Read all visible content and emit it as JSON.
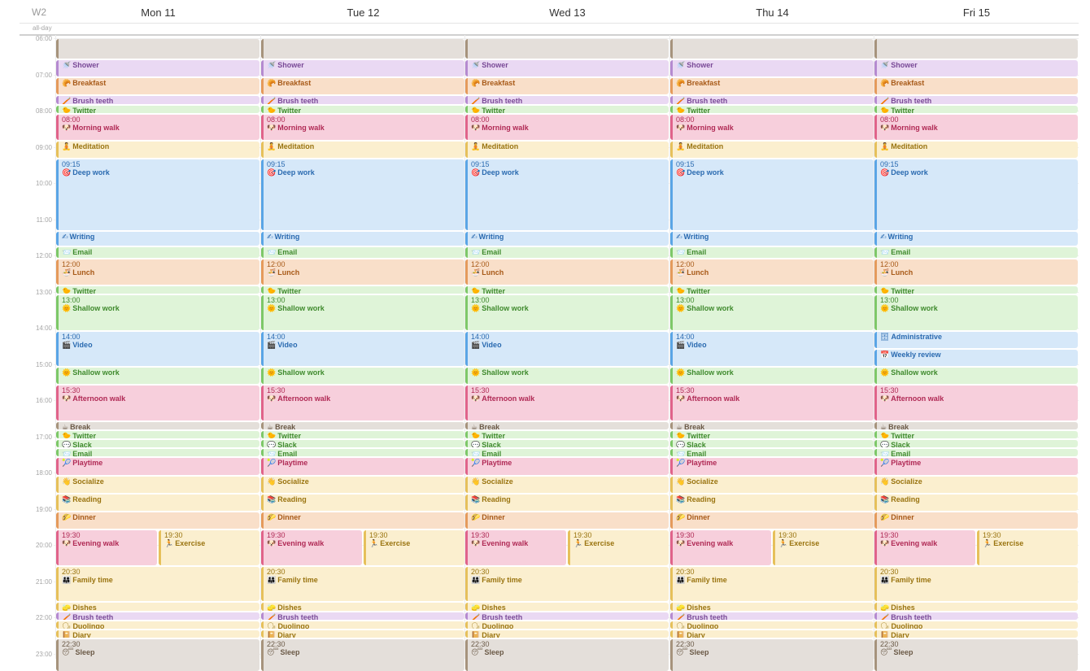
{
  "week_label": "W2",
  "all_day_label": "all-day",
  "days": [
    "Mon 11",
    "Tue 12",
    "Wed 13",
    "Thu 14",
    "Fri 15"
  ],
  "hours": [
    "06:00",
    "07:00",
    "08:00",
    "09:00",
    "10:00",
    "11:00",
    "12:00",
    "13:00",
    "14:00",
    "15:00",
    "16:00",
    "17:00",
    "18:00",
    "19:00",
    "20:00",
    "21:00",
    "22:00",
    "23:00"
  ],
  "categories": {
    "grey": {
      "bg": "#e4dfda",
      "bar": "#a6937c",
      "text": "#6b5a47"
    },
    "purple": {
      "bg": "#ead9f3",
      "bar": "#b58ad0",
      "text": "#7a4a97"
    },
    "orange": {
      "bg": "#f9dfc9",
      "bar": "#e59a5b",
      "text": "#a85a18"
    },
    "green": {
      "bg": "#dff4d8",
      "bar": "#7dc868",
      "text": "#3f8a2d"
    },
    "pink": {
      "bg": "#f7cfdc",
      "bar": "#e0638a",
      "text": "#b02a55"
    },
    "yellow": {
      "bg": "#fbefcf",
      "bar": "#e6c05a",
      "text": "#9a7410"
    },
    "blue": {
      "bg": "#d6e8f9",
      "bar": "#5aa5e6",
      "text": "#2a6ab0"
    }
  },
  "events": [
    {
      "name": "",
      "start": "06:00",
      "end": "06:35",
      "cat": "grey",
      "icon": "",
      "show_time": false
    },
    {
      "name": "Shower",
      "start": "06:35",
      "end": "07:05",
      "cat": "purple",
      "icon": "shower-icon",
      "glyph": "🚿"
    },
    {
      "name": "Breakfast",
      "start": "07:05",
      "end": "07:35",
      "cat": "orange",
      "icon": "breakfast-icon",
      "glyph": "🥐"
    },
    {
      "name": "Brush teeth",
      "start": "07:35",
      "end": "07:50",
      "cat": "purple",
      "icon": "toothbrush-icon",
      "glyph": "🪥"
    },
    {
      "name": "Twitter",
      "start": "07:50",
      "end": "08:05",
      "cat": "green",
      "icon": "bird-icon",
      "glyph": "🐤"
    },
    {
      "name": "Morning walk",
      "start": "08:05",
      "end": "08:50",
      "cat": "pink",
      "icon": "dog-icon",
      "glyph": "🐶",
      "time": "08:00"
    },
    {
      "name": "Meditation",
      "start": "08:50",
      "end": "09:20",
      "cat": "yellow",
      "icon": "meditation-icon",
      "glyph": "🧘"
    },
    {
      "name": "Deep work",
      "start": "09:20",
      "end": "11:20",
      "cat": "blue",
      "icon": "target-icon",
      "glyph": "🎯",
      "time": "09:15"
    },
    {
      "name": "Writing",
      "start": "11:20",
      "end": "11:45",
      "cat": "blue",
      "icon": "writing-hand-icon",
      "glyph": "✍"
    },
    {
      "name": "Email",
      "start": "11:45",
      "end": "12:05",
      "cat": "green",
      "icon": "email-icon",
      "glyph": "📨"
    },
    {
      "name": "Lunch",
      "start": "12:05",
      "end": "12:50",
      "cat": "orange",
      "icon": "bowl-icon",
      "glyph": "🍜",
      "time": "12:00"
    },
    {
      "name": "Twitter",
      "start": "12:50",
      "end": "13:05",
      "cat": "green",
      "icon": "bird-icon",
      "glyph": "🐤"
    },
    {
      "name": "Shallow work",
      "start": "13:05",
      "end": "14:05",
      "cat": "green",
      "icon": "sun-icon",
      "glyph": "🌞",
      "time": "13:00"
    },
    {
      "name": "Video",
      "start": "14:05",
      "end": "15:05",
      "cat": "blue",
      "icon": "clapper-icon",
      "glyph": "🎬",
      "time": "14:00",
      "except": [
        4
      ]
    },
    {
      "name": "Administrative",
      "start": "14:05",
      "end": "14:35",
      "cat": "blue",
      "icon": "cabinet-icon",
      "glyph": "🗄",
      "only": [
        4
      ]
    },
    {
      "name": "Weekly review",
      "start": "14:35",
      "end": "15:05",
      "cat": "blue",
      "icon": "calendar-icon",
      "glyph": "📅",
      "only": [
        4
      ]
    },
    {
      "name": "Shallow work",
      "start": "15:05",
      "end": "15:35",
      "cat": "green",
      "icon": "sun-icon",
      "glyph": "🌞"
    },
    {
      "name": "Afternoon walk",
      "start": "15:35",
      "end": "16:35",
      "cat": "pink",
      "icon": "dog-icon",
      "glyph": "🐶",
      "time": "15:30"
    },
    {
      "name": "Break",
      "start": "16:35",
      "end": "16:50",
      "cat": "grey",
      "icon": "coffee-icon",
      "glyph": "☕"
    },
    {
      "name": "Twitter",
      "start": "16:50",
      "end": "17:05",
      "cat": "green",
      "icon": "bird-icon",
      "glyph": "🐤"
    },
    {
      "name": "Slack",
      "start": "17:05",
      "end": "17:20",
      "cat": "green",
      "icon": "chat-icon",
      "glyph": "💬"
    },
    {
      "name": "Email",
      "start": "17:20",
      "end": "17:35",
      "cat": "green",
      "icon": "email-icon",
      "glyph": "📨"
    },
    {
      "name": "Playtime",
      "start": "17:35",
      "end": "18:05",
      "cat": "pink",
      "icon": "ball-icon",
      "glyph": "🎾"
    },
    {
      "name": "Socialize",
      "start": "18:05",
      "end": "18:35",
      "cat": "yellow",
      "icon": "wave-icon",
      "glyph": "👋"
    },
    {
      "name": "Reading",
      "start": "18:35",
      "end": "19:05",
      "cat": "yellow",
      "icon": "books-icon",
      "glyph": "📚"
    },
    {
      "name": "Dinner",
      "start": "19:05",
      "end": "19:35",
      "cat": "orange",
      "icon": "dinner-icon",
      "glyph": "🌮"
    },
    {
      "name": "Evening walk",
      "start": "19:35",
      "end": "20:35",
      "cat": "pink",
      "icon": "dog-icon",
      "glyph": "🐶",
      "time": "19:30",
      "half": "left"
    },
    {
      "name": "Exercise",
      "start": "19:35",
      "end": "20:35",
      "cat": "yellow",
      "icon": "runner-icon",
      "glyph": "🏃",
      "time": "19:30",
      "half": "right"
    },
    {
      "name": "Family time",
      "start": "20:35",
      "end": "21:35",
      "cat": "yellow",
      "icon": "family-icon",
      "glyph": "👨‍👩‍👧",
      "time": "20:30"
    },
    {
      "name": "Dishes",
      "start": "21:35",
      "end": "21:50",
      "cat": "yellow",
      "icon": "dishes-icon",
      "glyph": "🧽"
    },
    {
      "name": "Brush teeth",
      "start": "21:50",
      "end": "22:05",
      "cat": "purple",
      "icon": "toothbrush-icon",
      "glyph": "🪥"
    },
    {
      "name": "Duolingo",
      "start": "22:05",
      "end": "22:20",
      "cat": "yellow",
      "icon": "speech-icon",
      "glyph": "🗣"
    },
    {
      "name": "Diary",
      "start": "22:20",
      "end": "22:35",
      "cat": "yellow",
      "icon": "notebook-icon",
      "glyph": "📔"
    },
    {
      "name": "Sleep",
      "start": "22:35",
      "end": "23:30",
      "cat": "grey",
      "icon": "sleep-icon",
      "glyph": "😴",
      "time": "22:30"
    }
  ]
}
